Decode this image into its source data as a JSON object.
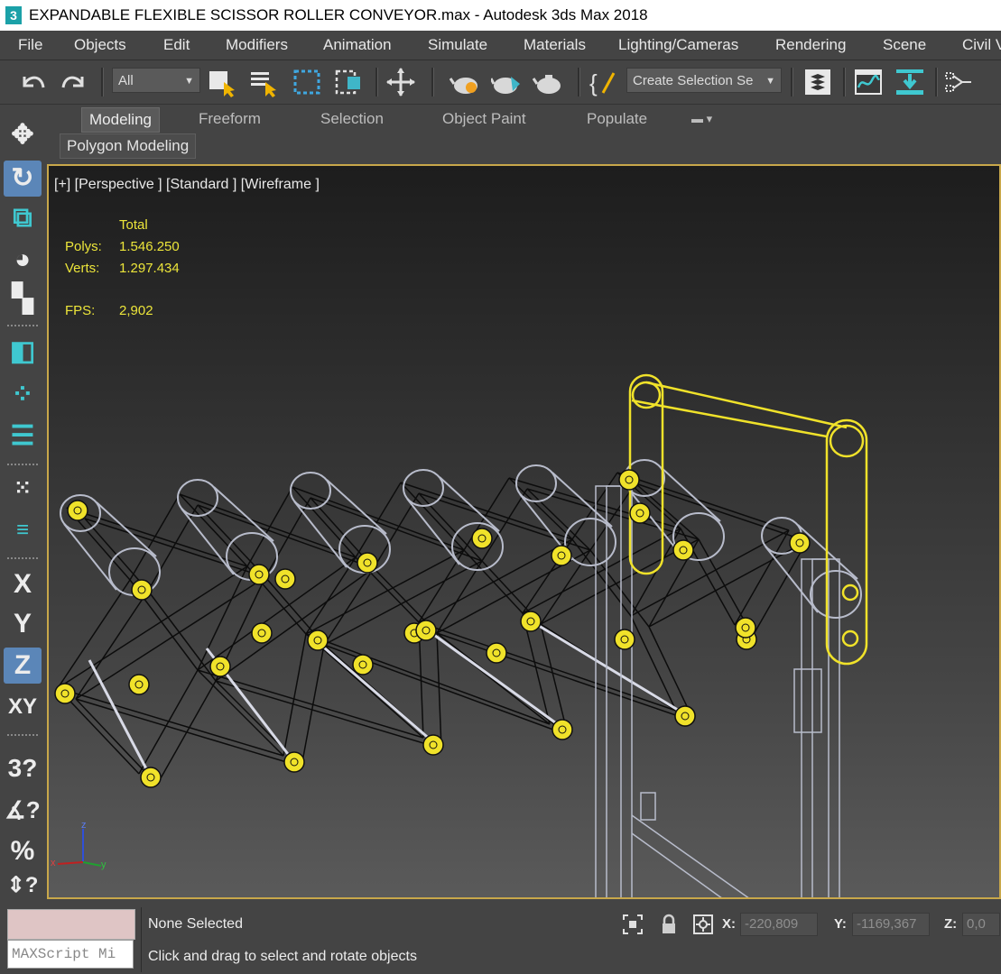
{
  "title_bar": {
    "app_icon_label": "3",
    "title": "EXPANDABLE FLEXIBLE SCISSOR ROLLER CONVEYOR.max - Autodesk 3ds Max 2018"
  },
  "menu": {
    "items": [
      "File",
      "Objects",
      "Edit",
      "Modifiers",
      "Animation",
      "Simulate",
      "Materials",
      "Lighting/Cameras",
      "Rendering",
      "Scene",
      "Civil V"
    ]
  },
  "toolbar": {
    "icons": [
      "undo-icon",
      "redo-icon",
      "select-object-icon",
      "select-by-name-icon",
      "rectangular-selection-icon",
      "window-crossing-icon",
      "select-and-move-icon",
      "render-setup-icon",
      "rendered-frame-window-icon",
      "render-production-icon",
      "edit-named-selection-icon",
      "layer-explorer-icon",
      "curve-editor-icon",
      "toggle-ribbon-icon",
      "schematic-view-icon"
    ],
    "filter_selected": "All",
    "named_selection_placeholder": "Create Selection Se"
  },
  "ribbon": {
    "tabs": [
      "Modeling",
      "Freeform",
      "Selection",
      "Object Paint",
      "Populate"
    ],
    "active_tab": "Modeling",
    "sub_panel": "Polygon Modeling"
  },
  "left_tools": {
    "items": [
      {
        "name": "select-and-move-icon",
        "glyph": "✥"
      },
      {
        "name": "select-and-rotate-icon",
        "glyph": "↻",
        "active": true
      },
      {
        "name": "select-and-scale-icon",
        "glyph": "⧉"
      },
      {
        "name": "select-and-place-icon",
        "glyph": "◕"
      },
      {
        "name": "create-icon",
        "glyph": "▚"
      },
      {
        "name": "mirror-icon",
        "glyph": "◧"
      },
      {
        "name": "selection-region-icon",
        "glyph": "⁘"
      },
      {
        "name": "align-icon",
        "glyph": "☰"
      },
      {
        "name": "snaps-a-icon",
        "glyph": "⁙"
      },
      {
        "name": "measure-icon",
        "glyph": "≡"
      },
      {
        "name": "constraint-x-label",
        "glyph": "X"
      },
      {
        "name": "constraint-y-label",
        "glyph": "Y"
      },
      {
        "name": "constraint-z-label",
        "glyph": "Z",
        "active": true
      },
      {
        "name": "constraint-xy-label",
        "glyph": "XY"
      },
      {
        "name": "snap-3d-icon",
        "glyph": "3?"
      },
      {
        "name": "angle-snap-icon",
        "glyph": "∡?"
      },
      {
        "name": "percent-snap-icon",
        "glyph": "%"
      },
      {
        "name": "spinner-snap-icon",
        "glyph": "⇕?"
      }
    ]
  },
  "viewport": {
    "label": "[+] [Perspective ] [Standard ] [Wireframe ]",
    "stats": {
      "header": "Total",
      "polys_label": "Polys:",
      "polys_value": "1.546.250",
      "verts_label": "Verts:",
      "verts_value": "1.297.434",
      "fps_label": "FPS:",
      "fps_value": "2,902"
    },
    "axis_labels": {
      "z": "z",
      "x": "x",
      "y": "y"
    }
  },
  "status_bar": {
    "maxscript_placeholder": "MAXScript Mi",
    "selection_text": "None Selected",
    "prompt_text": "Click and drag to select and rotate objects",
    "x_label": "X:",
    "x_value": "-220,809",
    "y_label": "Y:",
    "y_value": "-1169,367",
    "z_label": "Z:",
    "z_value": "0,0"
  },
  "colors": {
    "viewport_border": "#c8a74a",
    "stats_text": "#ece53a",
    "selected_wire": "#f0e22a",
    "wire_unselected": "#b8bccb",
    "active_tool": "#5b86b8"
  }
}
